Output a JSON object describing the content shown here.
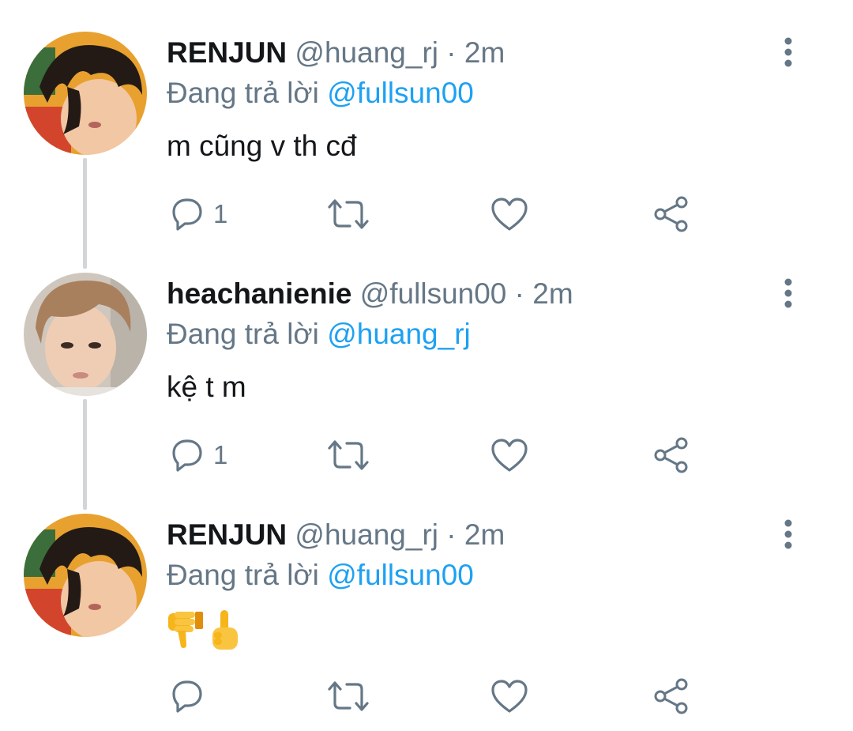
{
  "thread": [
    {
      "display_name": "RENJUN",
      "handle": "@huang_rj",
      "time": "· 2m",
      "reply_prefix": "Đang trả lời",
      "reply_to": "@fullsun00",
      "text": "m cũng v th cđ",
      "reply_count": "1",
      "emojis": []
    },
    {
      "display_name": "heachanienie",
      "handle": "@fullsun00",
      "time": "· 2m",
      "reply_prefix": "Đang trả lời",
      "reply_to": "@huang_rj",
      "text": "kệ t m",
      "reply_count": "1",
      "emojis": []
    },
    {
      "display_name": "RENJUN",
      "handle": "@huang_rj",
      "time": "· 2m",
      "reply_prefix": "Đang trả lời",
      "reply_to": "@fullsun00",
      "text": "",
      "reply_count": "",
      "emojis": [
        "thumbs-down",
        "pointing-up"
      ]
    }
  ],
  "icons": {
    "reply": "speech-bubble-icon",
    "retweet": "retweet-icon",
    "like": "heart-icon",
    "share": "share-icon",
    "more": "vertical-dots-icon"
  },
  "colors": {
    "link": "#1da1f2",
    "secondary_text": "#657786",
    "icon": "#657786",
    "thread_line": "#d3d6d9"
  }
}
